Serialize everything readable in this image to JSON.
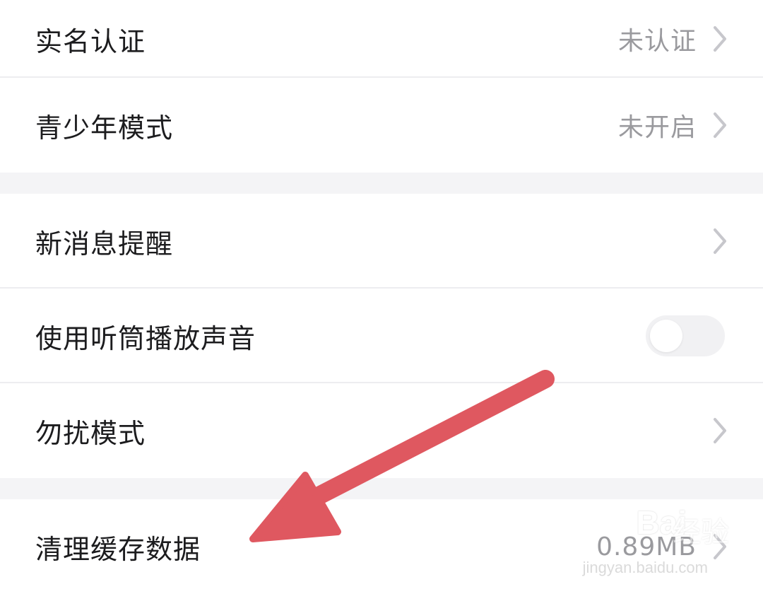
{
  "settings": {
    "group1": [
      {
        "label": "实名认证",
        "value": "未认证"
      },
      {
        "label": "青少年模式",
        "value": "未开启"
      }
    ],
    "group2": [
      {
        "label": "新消息提醒"
      },
      {
        "label": "使用听筒播放声音",
        "toggle_on": false
      },
      {
        "label": "勿扰模式"
      }
    ],
    "group3": [
      {
        "label": "清理缓存数据",
        "value": "0.89MB"
      }
    ]
  },
  "watermark": {
    "brand": "Bai",
    "sub": "经验",
    "url": "jingyan.baidu.com"
  },
  "colors": {
    "arrow": "#df5860",
    "chevron": "#c7c7cc",
    "background": "#f4f4f6"
  },
  "icons": {
    "chevron": "chevron-right-icon",
    "arrow": "annotation-arrow"
  }
}
